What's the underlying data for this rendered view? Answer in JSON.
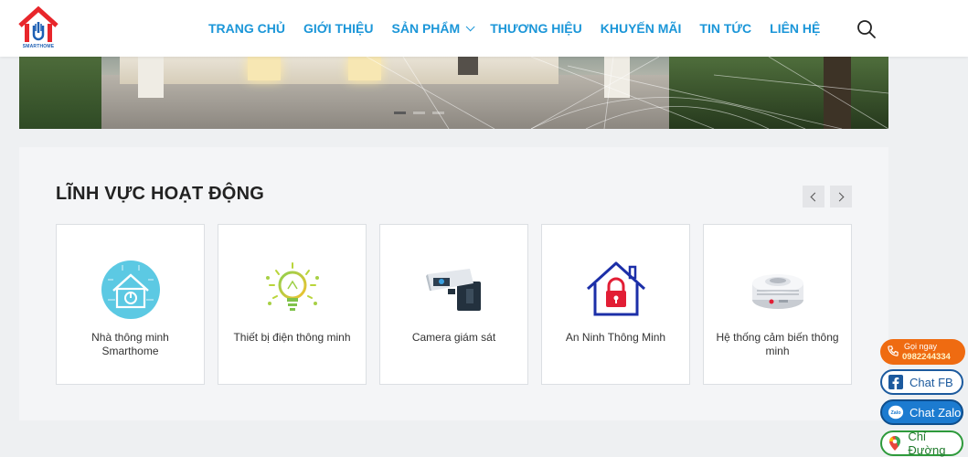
{
  "header": {
    "logo_text": "SMARTHOME",
    "nav": [
      {
        "label": "TRANG CHỦ"
      },
      {
        "label": "GIỚI THIỆU"
      },
      {
        "label": "SẢN PHẨM"
      },
      {
        "label": "THƯƠNG HIỆU"
      },
      {
        "label": "KHUYẾN MÃI"
      },
      {
        "label": "TIN TỨC"
      },
      {
        "label": "LIÊN HỆ"
      }
    ],
    "search_icon": "search-icon"
  },
  "banner": {
    "slide_count": 3,
    "active_slide": 1
  },
  "section": {
    "title": "LĨNH VỰC HOẠT ĐỘNG",
    "cards": [
      {
        "label": "Nhà thông minh Smarthome",
        "icon": "smart-home-icon"
      },
      {
        "label": "Thiết bị điện thông minh",
        "icon": "smart-bulb-icon"
      },
      {
        "label": "Camera giám sát",
        "icon": "security-camera-icon"
      },
      {
        "label": "An Ninh Thông Minh",
        "icon": "house-lock-icon"
      },
      {
        "label": "Hệ thống cảm biến thông minh",
        "icon": "smoke-sensor-icon"
      }
    ]
  },
  "contact": {
    "call_label": "Gọi ngay",
    "call_number": "0982244334",
    "fb_label": "Chat FB",
    "zalo_label": "Chat Zalo",
    "map_label": "Chỉ Đường"
  },
  "colors": {
    "nav": "#1b96d8",
    "brand_red": "#e8262b",
    "call": "#ef6b11",
    "facebook": "#1c5a9e",
    "zalo": "#1c7bd0",
    "map": "#2e9a3b"
  }
}
